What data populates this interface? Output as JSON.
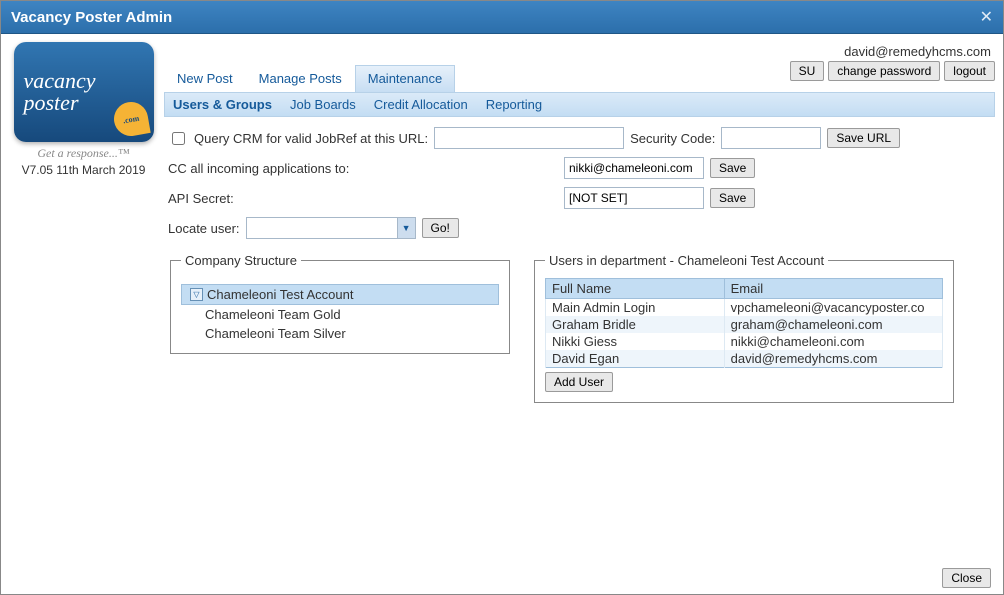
{
  "window": {
    "title": "Vacancy Poster Admin"
  },
  "logo": {
    "line1": "vacancy",
    "line2": "poster",
    "corner": ".com",
    "tagline": "Get a response...™",
    "version": "V7.05 11th March 2019"
  },
  "userEmail": "david@remedyhcms.com",
  "tabs": {
    "items": [
      "New Post",
      "Manage Posts",
      "Maintenance"
    ],
    "activeIndex": 2
  },
  "rightButtons": {
    "su": "SU",
    "changePassword": "change password",
    "logout": "logout"
  },
  "subtabs": {
    "items": [
      "Users & Groups",
      "Job Boards",
      "Credit Allocation",
      "Reporting"
    ],
    "activeIndex": 0
  },
  "crm": {
    "label": "Query CRM for valid JobRef at this URL:",
    "urlValue": "",
    "securityLabel": "Security Code:",
    "securityValue": "",
    "saveUrl": "Save URL"
  },
  "cc": {
    "label": "CC all incoming applications to:",
    "value": "nikki@chameleoni.com",
    "save": "Save"
  },
  "api": {
    "label": "API Secret:",
    "value": "[NOT SET]",
    "save": "Save"
  },
  "locate": {
    "label": "Locate user:",
    "go": "Go!"
  },
  "companyStructure": {
    "legend": "Company Structure",
    "root": "Chameleoni Test Account",
    "children": [
      "Chameleoni Team Gold",
      "Chameleoni Team Silver"
    ]
  },
  "usersPanel": {
    "legend": "Users in department - Chameleoni Test Account",
    "headers": {
      "name": "Full Name",
      "email": "Email"
    },
    "rows": [
      {
        "name": "Main Admin Login",
        "email": "vpchameleoni@vacancyposter.co"
      },
      {
        "name": "Graham Bridle",
        "email": "graham@chameleoni.com"
      },
      {
        "name": "Nikki Giess",
        "email": "nikki@chameleoni.com"
      },
      {
        "name": "David Egan",
        "email": "david@remedyhcms.com"
      }
    ],
    "addUser": "Add User"
  },
  "footer": {
    "close": "Close"
  }
}
